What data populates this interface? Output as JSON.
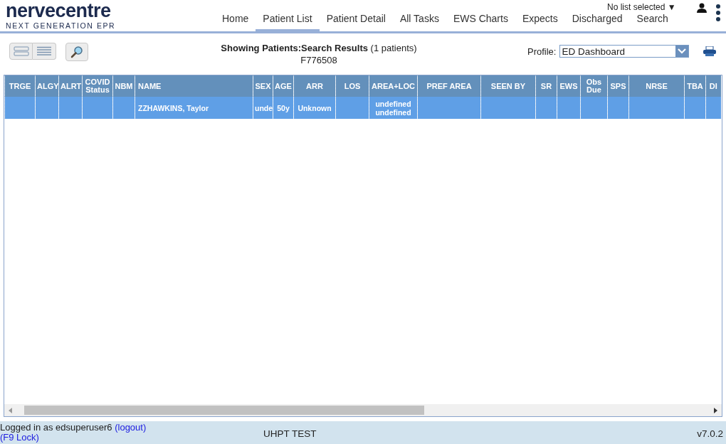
{
  "logo": {
    "name": "nervecentre",
    "tagline": "NEXT GENERATION EPR"
  },
  "nav": [
    {
      "label": "Home",
      "selected": false
    },
    {
      "label": "Patient List",
      "selected": true
    },
    {
      "label": "Patient Detail",
      "selected": false
    },
    {
      "label": "All Tasks",
      "selected": false
    },
    {
      "label": "EWS Charts",
      "selected": false
    },
    {
      "label": "Expects",
      "selected": false
    },
    {
      "label": "Discharged",
      "selected": false
    },
    {
      "label": "Search",
      "selected": false
    }
  ],
  "list_selector": {
    "label": "No list selected",
    "caret": "▼"
  },
  "results": {
    "title": "Showing Patients:Search Results",
    "count": "(1 patients)",
    "query": "F776508"
  },
  "profile": {
    "label": "Profile:",
    "value": "ED Dashboard"
  },
  "table": {
    "columns": [
      {
        "label": "TRGE"
      },
      {
        "label": "ALGY"
      },
      {
        "label": "ALRT"
      },
      {
        "label": "COVID Status"
      },
      {
        "label": "NBM"
      },
      {
        "label": "NAME"
      },
      {
        "label": "SEX"
      },
      {
        "label": "AGE"
      },
      {
        "label": "ARR"
      },
      {
        "label": "LOS"
      },
      {
        "label": "AREA+LOC"
      },
      {
        "label": "PREF AREA"
      },
      {
        "label": "SEEN BY"
      },
      {
        "label": "SR"
      },
      {
        "label": "EWS"
      },
      {
        "label": "Obs Due"
      },
      {
        "label": "SPS"
      },
      {
        "label": "NRSE"
      },
      {
        "label": "TBA"
      },
      {
        "label": "DI"
      }
    ],
    "rows": [
      {
        "selected": true,
        "cells": [
          "",
          "",
          "",
          "",
          "",
          "ZZHAWKINS, Taylor",
          "unde",
          "50y",
          "Unknown",
          "",
          "undefined undefined",
          "",
          "",
          "",
          "",
          "",
          "",
          "",
          "",
          ""
        ]
      }
    ]
  },
  "footer": {
    "user_text": "Logged in as edsuperuser6",
    "logout": "(logout)",
    "lock": "(F9 Lock)",
    "environment": "UHPT TEST",
    "version": "v7.0.2"
  }
}
